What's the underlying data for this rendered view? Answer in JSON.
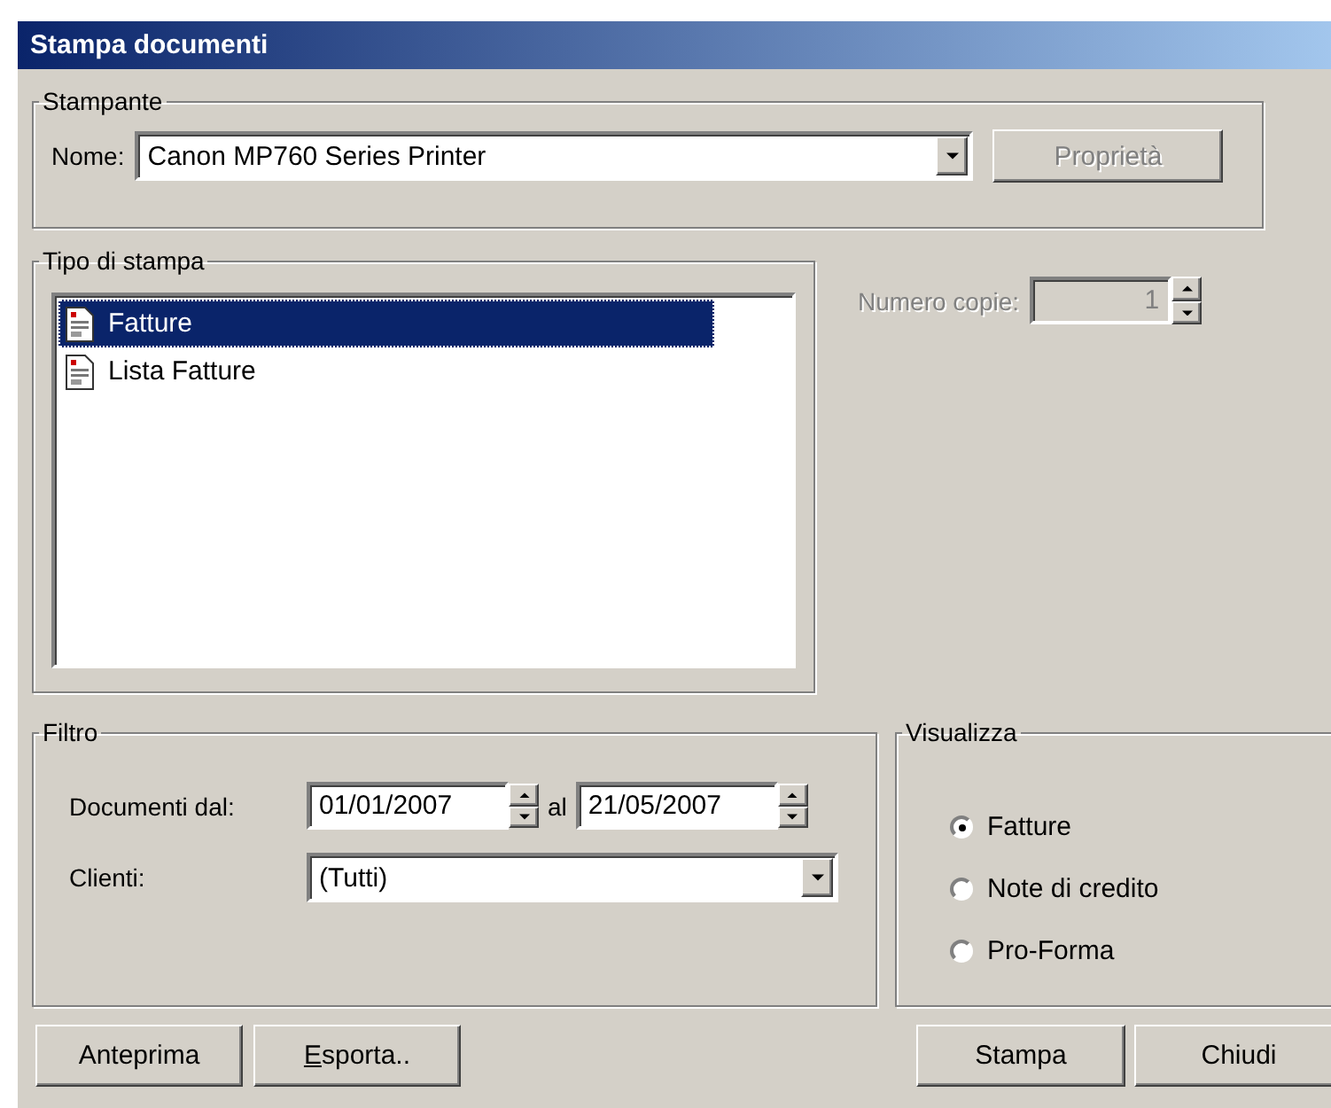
{
  "window": {
    "title": "Stampa documenti"
  },
  "printer": {
    "legend": "Stampante",
    "label": "Nome:",
    "value": "Canon MP760 Series Printer",
    "properties_button": {
      "label": "Proprietà",
      "disabled": true
    }
  },
  "print_type": {
    "legend": "Tipo di stampa",
    "items": [
      {
        "label": "Fatture",
        "selected": true
      },
      {
        "label": "Lista Fatture",
        "selected": false
      }
    ]
  },
  "copies": {
    "label": "Numero copie:",
    "value": "1",
    "disabled": true
  },
  "filter": {
    "legend": "Filtro",
    "date_label": "Documenti dal:",
    "date_from": "01/01/2007",
    "between": "al",
    "date_to": "21/05/2007",
    "clients_label": "Clienti:",
    "clients_value": "(Tutti)"
  },
  "view": {
    "legend": "Visualizza",
    "options": [
      {
        "label": "Fatture",
        "selected": true
      },
      {
        "label": "Note di credito",
        "selected": false
      },
      {
        "label": "Pro-Forma",
        "selected": false
      }
    ]
  },
  "buttons_left": [
    {
      "label": "Anteprima",
      "mnemonic": false
    },
    {
      "label": "Esporta..",
      "mnemonic": true
    }
  ],
  "buttons_right": [
    {
      "label": "Stampa",
      "mnemonic": false
    },
    {
      "label": "Chiudi",
      "mnemonic": false
    }
  ]
}
